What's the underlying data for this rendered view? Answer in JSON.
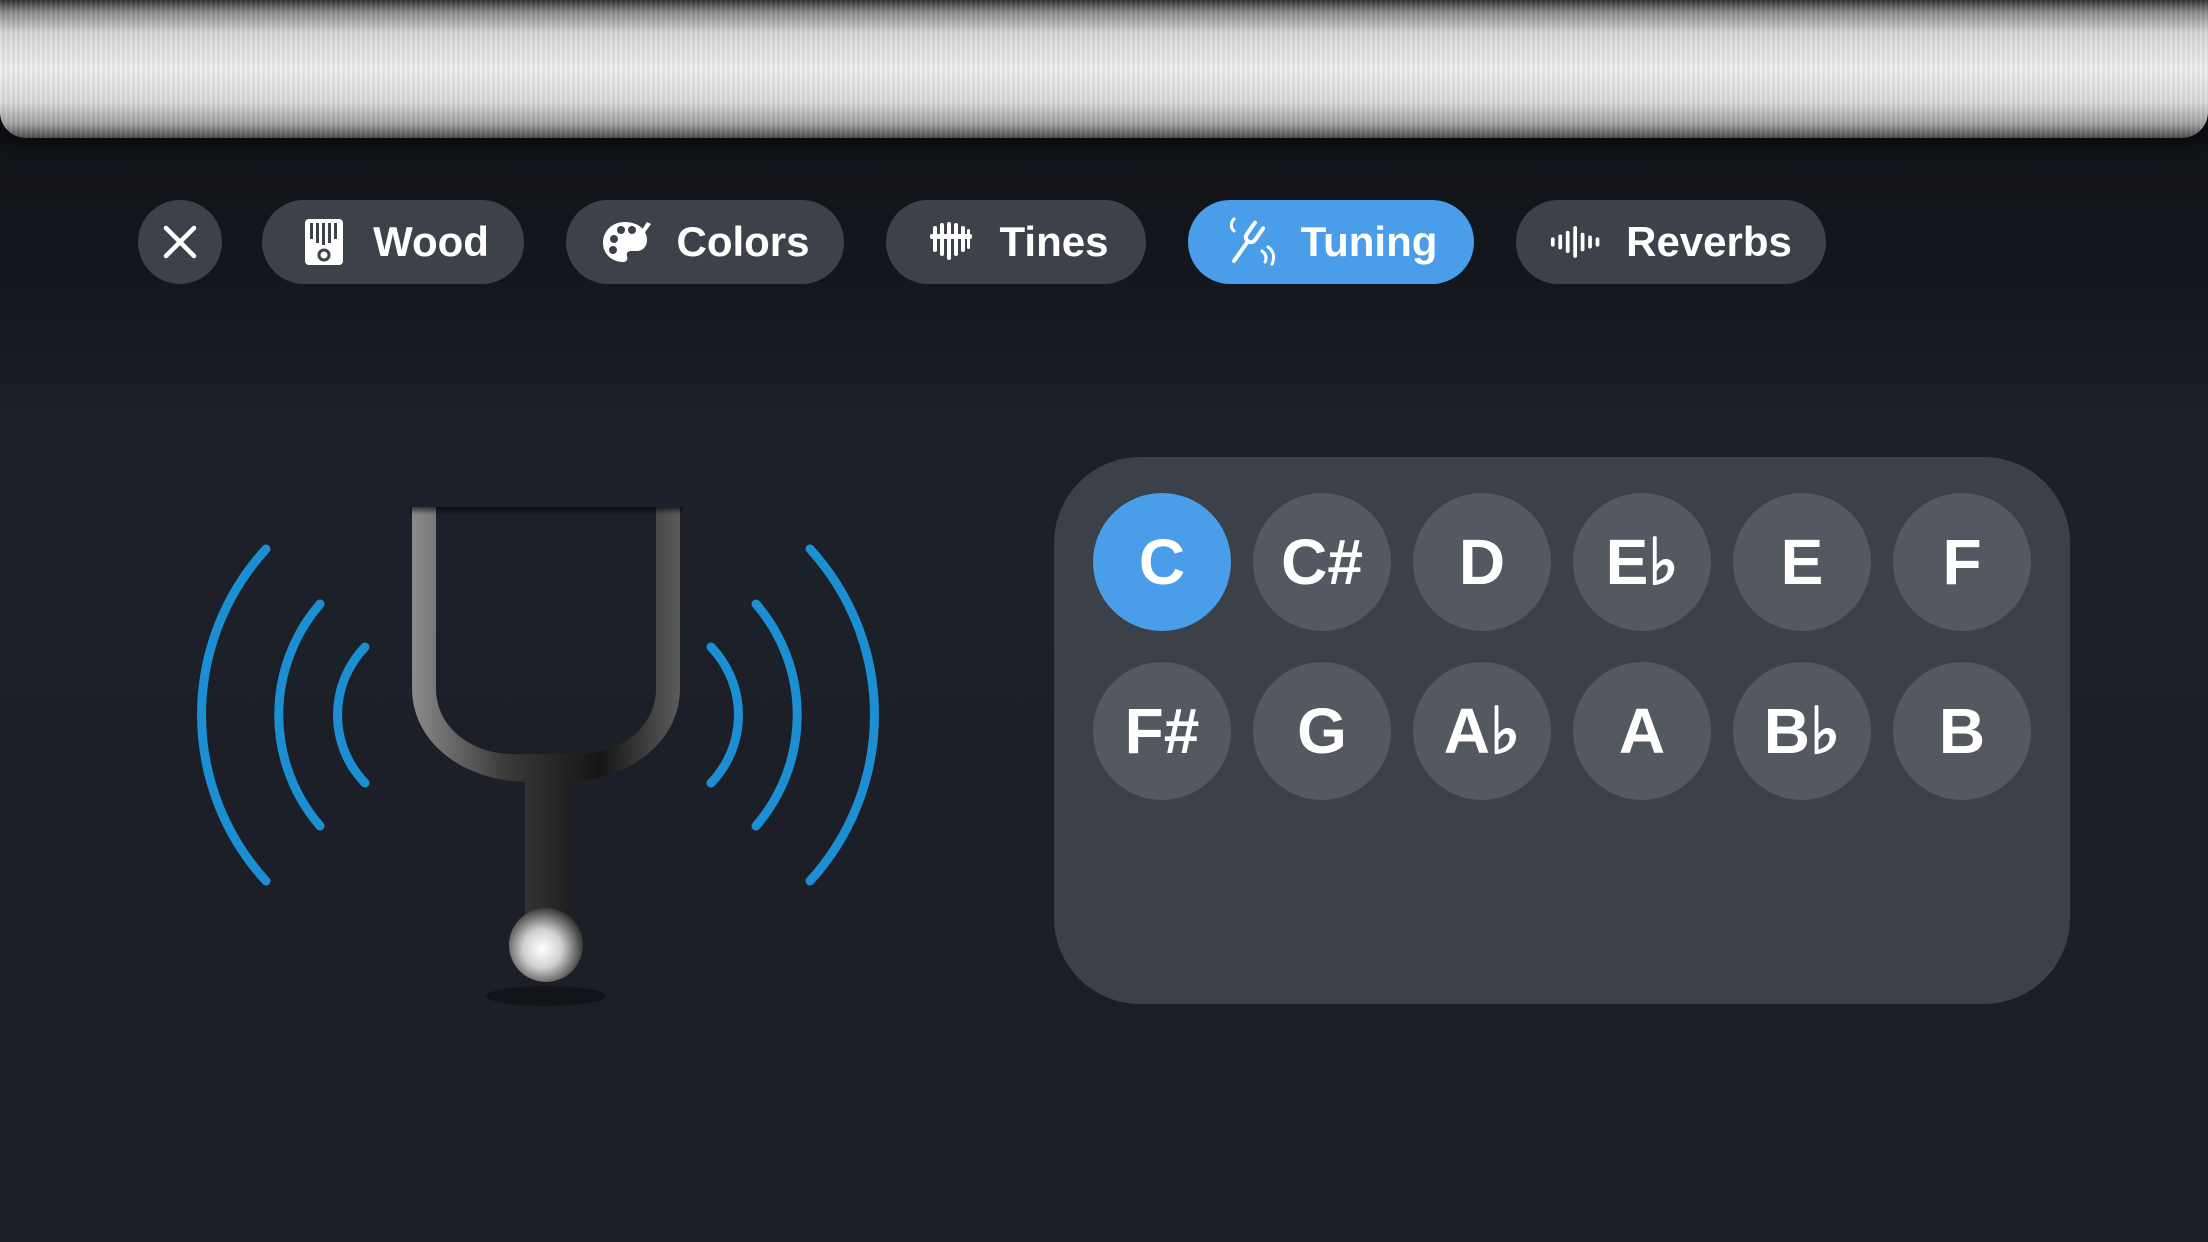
{
  "toolbar": {
    "close_icon": "close-icon",
    "tabs": [
      {
        "label": "Wood",
        "icon": "kalimba-icon",
        "active": false
      },
      {
        "label": "Colors",
        "icon": "palette-icon",
        "active": false
      },
      {
        "label": "Tines",
        "icon": "tines-icon",
        "active": false
      },
      {
        "label": "Tuning",
        "icon": "tuning-fork-icon",
        "active": true
      },
      {
        "label": "Reverbs",
        "icon": "waveform-icon",
        "active": false
      }
    ]
  },
  "illustration": {
    "icon": "tuning-fork-icon",
    "wave_color": "#1c8fd3"
  },
  "notes": {
    "selected": "C",
    "row1": [
      "C",
      "C#",
      "D",
      "E♭",
      "E",
      "F"
    ],
    "row2": [
      "F#",
      "G",
      "A♭",
      "A",
      "B♭",
      "B"
    ]
  },
  "colors": {
    "accent": "#4a9de9",
    "chip": "#3d4149",
    "panel": "#3c4048",
    "note": "#545860",
    "background": "#1c1f27"
  }
}
